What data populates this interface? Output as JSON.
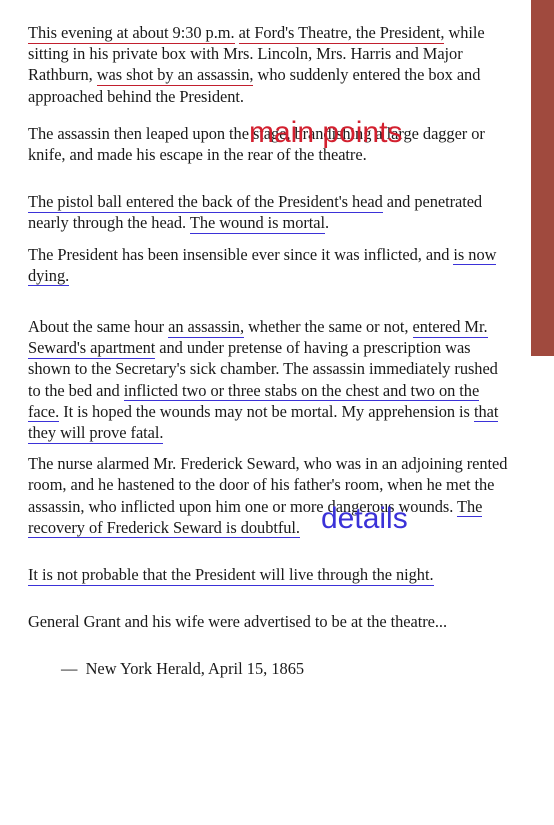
{
  "document": {
    "accent_bar_color": "#a04a3e",
    "highlight_colors": {
      "main_points": "#c21f2e",
      "details": "#3b32d8"
    },
    "annotations": [
      {
        "id": "main-points",
        "label": "main points",
        "color": "#d3202f"
      },
      {
        "id": "details",
        "label": "details",
        "color": "#3b32d8"
      }
    ],
    "paragraphs": {
      "p1": {
        "s1": "This evening at about 9:30 p.m.",
        "s2": " ",
        "s3": "at Ford's Theatre, the President,",
        "s4": " while sitting in his private box with Mrs. Lincoln, Mrs. Harris and Major Rathburn, ",
        "s5": "was shot by an assassin,",
        "s6": " who suddenly entered the box and approached behind the President."
      },
      "p2": {
        "s1": "The assassin then leaped upon the stage, brandishing a large dagger or knife, and made his escape in the rear of the theatre."
      },
      "p3": {
        "s1": "The pistol ball entered the back of the President's head",
        "s2": " and penetrated nearly through the head. ",
        "s3": "The wound is mortal",
        "s4": "."
      },
      "p4": {
        "s1": "The President has been insensible ever since it was inflicted, and ",
        "s2": "is now dying.",
        "s3": ""
      },
      "p5": {
        "s1": "About the same hour ",
        "s2": "an assassin,",
        "s3": " whether the same or not, ",
        "s4": "entered Mr. Seward's apartment",
        "s5": " and under pretense of having a prescription was shown to the Secretary's sick chamber. The assassin immediately rushed to the bed and ",
        "s6": "inflicted two or three stabs on the chest and two on the face.",
        "s7": " It is hoped the wounds may not be mortal. My apprehension is ",
        "s8": "that they will prove fatal.",
        "s9": ""
      },
      "p6": {
        "s1": "The nurse alarmed Mr. Frederick Seward, who was in an adjoining rented room, and he hastened to the door of his father's room, when he met the assassin, who inflicted upon him one or more dangerous wounds. ",
        "s2": "The recovery of Frederick Seward is doubtful.",
        "s3": ""
      },
      "p7": {
        "s1": "It is not probable that the President will live through the night.",
        "s2": ""
      },
      "p8": {
        "s1": "General Grant and his wife were advertised to be at the theatre..."
      }
    },
    "attribution": {
      "dash": "—",
      "text": "New York Herald, April 15, 1865"
    }
  }
}
